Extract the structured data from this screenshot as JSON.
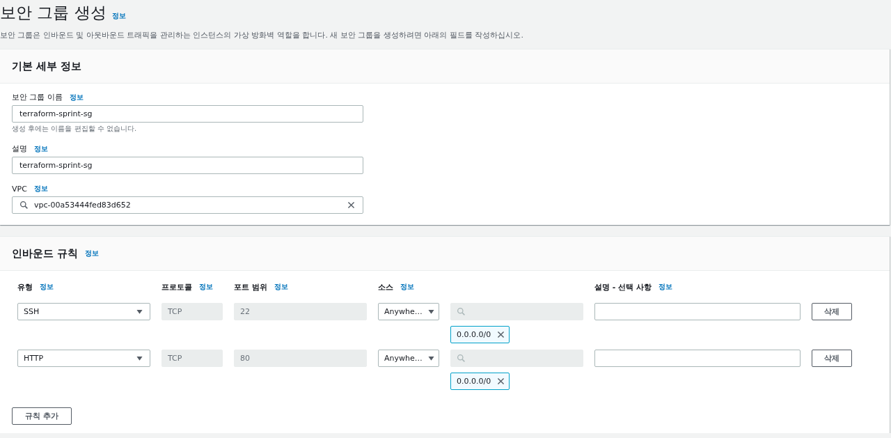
{
  "page": {
    "title": "보안 그룹 생성",
    "info": "정보",
    "description": "보안 그룹은 인바운드 및 아웃바운드 트래픽을 관리하는 인스턴스의 가상 방화벽 역할을 합니다. 새 보안 그룹을 생성하려면 아래의 필드를 작성하십시오."
  },
  "basic_details": {
    "heading": "기본 세부 정보",
    "fields": [
      {
        "kind": "text",
        "label": "보안 그룹 이름",
        "info": "정보",
        "value": "terraform-sprint-sg",
        "hint": "생성 후에는 이름을 편집할 수 없습니다."
      },
      {
        "kind": "text",
        "label": "설명",
        "info": "정보",
        "value": "terraform-sprint-sg"
      },
      {
        "kind": "search",
        "label": "VPC",
        "info": "정보",
        "value": "vpc-00a53444fed83d652"
      }
    ]
  },
  "inbound_rules": {
    "heading": "인바운드 규칙",
    "info": "정보",
    "columns": [
      {
        "label": "유형",
        "info": "정보"
      },
      {
        "label": "프로토콜",
        "info": "정보"
      },
      {
        "label": "포트 범위",
        "info": "정보"
      },
      {
        "label": "소스",
        "info": "정보"
      },
      {
        "label": "설명 - 선택 사항",
        "info": "정보"
      }
    ],
    "rules": [
      {
        "type": "SSH",
        "protocol": {
          "value": "TCP",
          "disabled": true
        },
        "port_range": {
          "value": "22",
          "disabled": true
        },
        "source": "Anywhe…",
        "cidr": "0.0.0.0/0",
        "delete": "삭제"
      },
      {
        "type": "HTTP",
        "protocol": {
          "value": "TCP",
          "disabled": true
        },
        "port_range": {
          "value": "80",
          "disabled": true
        },
        "source": "Anywhe…",
        "cidr": "0.0.0.0/0",
        "delete": "삭제"
      }
    ],
    "add_button": "규칙 추가"
  }
}
